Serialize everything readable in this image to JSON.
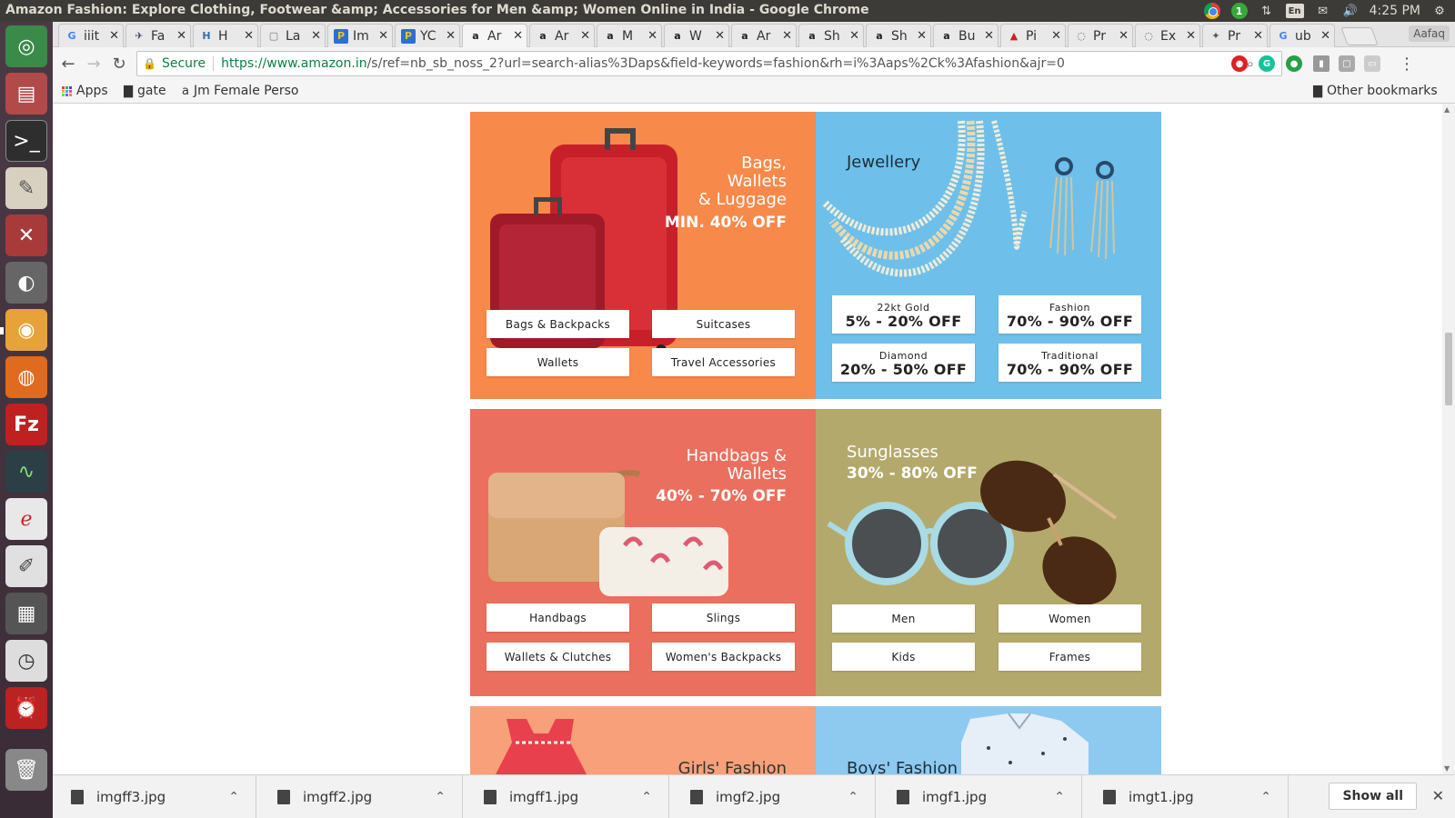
{
  "window": {
    "title": "Amazon Fashion: Explore Clothing, Footwear &amp; Accessories for Men &amp; Women Online in India - Google Chrome"
  },
  "tray": {
    "badge": "1",
    "lang": "En",
    "time": "4:25 PM"
  },
  "tabs": [
    {
      "favicon": "G",
      "label": "iiit"
    },
    {
      "favicon": "✈",
      "label": "Fa"
    },
    {
      "favicon": "H",
      "label": "H"
    },
    {
      "favicon": "▢",
      "label": "La"
    },
    {
      "favicon": "P",
      "label": "Im"
    },
    {
      "favicon": "P",
      "label": "YC"
    },
    {
      "favicon": "a",
      "label": "Ar"
    },
    {
      "favicon": "a",
      "label": "Ar"
    },
    {
      "favicon": "a",
      "label": "M"
    },
    {
      "favicon": "a",
      "label": "W"
    },
    {
      "favicon": "a",
      "label": "Ar"
    },
    {
      "favicon": "a",
      "label": "Sh"
    },
    {
      "favicon": "a",
      "label": "Sh"
    },
    {
      "favicon": "a",
      "label": "Bu"
    },
    {
      "favicon": "▲",
      "label": "Pi"
    },
    {
      "favicon": "◌",
      "label": "Pr"
    },
    {
      "favicon": "◌",
      "label": "Ex"
    },
    {
      "favicon": "✦",
      "label": "Pr"
    },
    {
      "favicon": "G",
      "label": "ub"
    }
  ],
  "profile": "Aafaq",
  "omnibox": {
    "secure_label": "Secure",
    "url_host": "https://www.amazon.in",
    "url_rest": "/s/ref=nb_sb_noss_2?url=search-alias%3Daps&field-keywords=fashion&rh=i%3Aaps%2Ck%3Afashion&ajr=0"
  },
  "bookmarks": {
    "apps": "Apps",
    "gate": "gate",
    "jm": "Jm Female Perso",
    "other": "Other bookmarks"
  },
  "tiles": {
    "bags": {
      "heading_1": "Bags,",
      "heading_2": "Wallets",
      "heading_3": "& Luggage",
      "offer": "MIN. 40% OFF",
      "buttons": [
        "Bags & Backpacks",
        "Suitcases",
        "Wallets",
        "Travel Accessories"
      ],
      "bg": "#f7894a"
    },
    "jewellery": {
      "heading": "Jewellery",
      "buttons": [
        {
          "label": "22kt Gold",
          "offer": "5% - 20% OFF"
        },
        {
          "label": "Fashion",
          "offer": "70% - 90% OFF"
        },
        {
          "label": "Diamond",
          "offer": "20% - 50% OFF"
        },
        {
          "label": "Traditional",
          "offer": "70% - 90% OFF"
        }
      ],
      "bg": "#6ec0ea"
    },
    "handbags": {
      "heading_1": "Handbags &",
      "heading_2": "Wallets",
      "offer": "40% - 70% OFF",
      "buttons": [
        "Handbags",
        "Slings",
        "Wallets & Clutches",
        "Women's Backpacks"
      ],
      "bg": "#ea6f5e"
    },
    "sunglasses": {
      "heading": "Sunglasses",
      "offer": "30% - 80% OFF",
      "buttons": [
        "Men",
        "Women",
        "Kids",
        "Frames"
      ],
      "bg": "#b4a96c"
    },
    "girls": {
      "heading": "Girls' Fashion",
      "bg": "#f7a079"
    },
    "boys": {
      "heading": "Boys' Fashion",
      "bg": "#8ec9ef"
    }
  },
  "downloads": {
    "items": [
      "imgff3.jpg",
      "imgff2.jpg",
      "imgff1.jpg",
      "imgf2.jpg",
      "imgf1.jpg",
      "imgt1.jpg"
    ],
    "show_all": "Show all"
  }
}
